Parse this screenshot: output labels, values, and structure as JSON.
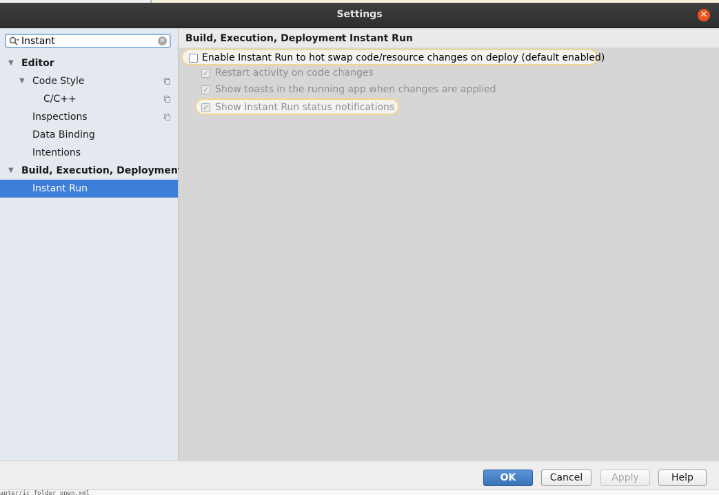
{
  "window": {
    "title": "Settings",
    "close_icon": "close-icon"
  },
  "search": {
    "value": "Instant",
    "icon": "search-icon",
    "clear_icon": "clear-icon"
  },
  "tree": {
    "items": [
      {
        "label": "Editor",
        "level": 0,
        "expanded": true,
        "bold": true
      },
      {
        "label": "Code Style",
        "level": 1,
        "expanded": true,
        "copy_icon": true
      },
      {
        "label": "C/C++",
        "level": 2,
        "copy_icon": true
      },
      {
        "label": "Inspections",
        "level": 1,
        "copy_icon": true
      },
      {
        "label": "Data Binding",
        "level": 1
      },
      {
        "label": "Intentions",
        "level": 1
      },
      {
        "label": "Build, Execution, Deployment",
        "level": 0,
        "expanded": true,
        "bold": true
      },
      {
        "label": "Instant Run",
        "level": 1,
        "selected": true
      }
    ]
  },
  "breadcrumb": {
    "parent": "Build, Execution, Deployment",
    "separator": "›",
    "current": "Instant Run"
  },
  "options": [
    {
      "label": "Enable Instant Run to hot swap code/resource changes on deploy (default enabled)",
      "checked": false,
      "enabled": true,
      "highlighted": true
    },
    {
      "label": "Restart activity on code changes",
      "checked": true,
      "enabled": false,
      "highlighted": false
    },
    {
      "label": "Show toasts in the running app when changes are applied",
      "checked": true,
      "enabled": false,
      "highlighted": false
    },
    {
      "label": "Show Instant Run status notifications",
      "checked": true,
      "enabled": false,
      "highlighted": true
    }
  ],
  "buttons": {
    "ok": "OK",
    "cancel": "Cancel",
    "apply": "Apply",
    "help": "Help"
  },
  "background_text": "apter/ic folder open.xml",
  "colors": {
    "selection": "#3d7ed9",
    "highlight_border": "#f4d58a",
    "close_button": "#e9541f",
    "ok_button": "#3b73b8"
  }
}
